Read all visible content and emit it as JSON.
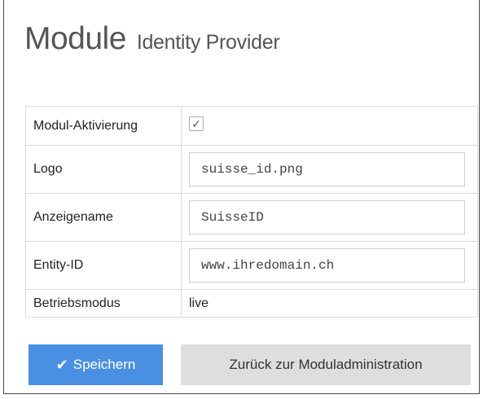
{
  "header": {
    "title": "Module",
    "subtitle": "Identity Provider"
  },
  "form": {
    "activation": {
      "label": "Modul-Aktivierung",
      "checked": true,
      "check_glyph": "✓"
    },
    "logo": {
      "label": "Logo",
      "value": "suisse_id.png"
    },
    "display_name": {
      "label": "Anzeigename",
      "value": "SuisseID"
    },
    "entity_id": {
      "label": "Entity-ID",
      "value": "www.ihredomain.ch"
    },
    "mode": {
      "label": "Betriebsmodus",
      "value": "live"
    }
  },
  "actions": {
    "save_label": "Speichern",
    "save_icon": "check-icon",
    "back_label": "Zurück zur Moduladministration"
  },
  "colors": {
    "primary": "#4a90e2",
    "secondary": "#dedede",
    "title": "#555555"
  }
}
